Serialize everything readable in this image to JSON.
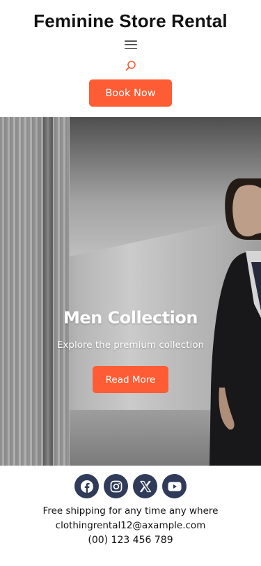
{
  "header": {
    "site_title": "Feminine Store Rental",
    "menu_icon": "menu-icon",
    "search_icon": "search-icon",
    "book_button": "Book Now"
  },
  "hero": {
    "title": "Men Collection",
    "subtitle": "Explore the premium collection",
    "button": "Read More"
  },
  "footer": {
    "socials": [
      {
        "name": "facebook-icon"
      },
      {
        "name": "instagram-icon"
      },
      {
        "name": "x-icon"
      },
      {
        "name": "youtube-icon"
      }
    ],
    "shipping": "Free shipping for any time any where",
    "email": "clothingrental12@axample.com",
    "phone": "(00) 123 456 789"
  },
  "colors": {
    "accent": "#fd5c35",
    "social_bg": "#2f3b59"
  }
}
